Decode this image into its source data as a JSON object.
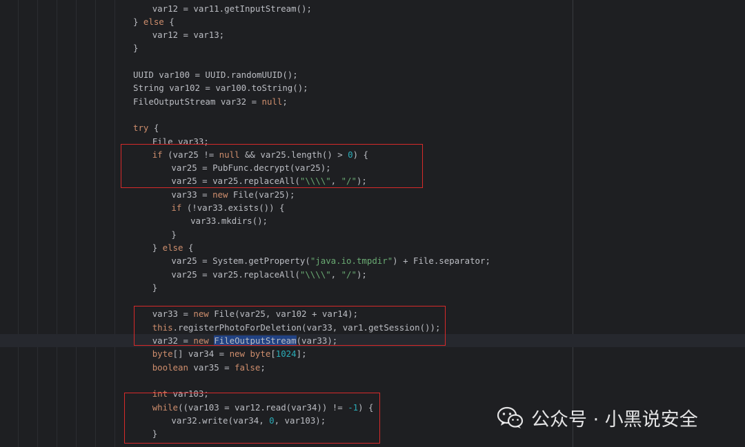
{
  "code_lines": [
    [
      {
        "t": "var12 = var11.getInputStream();",
        "c": ""
      }
    ],
    [
      {
        "t": "} ",
        "c": ""
      },
      {
        "t": "else",
        "c": "kw"
      },
      {
        "t": " {",
        "c": ""
      }
    ],
    [
      {
        "t": "var12 = var13;",
        "c": ""
      }
    ],
    [
      {
        "t": "}",
        "c": ""
      }
    ],
    [],
    [
      {
        "t": "UUID var100 = UUID.randomUUID();",
        "c": ""
      }
    ],
    [
      {
        "t": "String var102 = var100.toString();",
        "c": ""
      }
    ],
    [
      {
        "t": "FileOutputStream var32 = ",
        "c": ""
      },
      {
        "t": "null",
        "c": "kw"
      },
      {
        "t": ";",
        "c": ""
      }
    ],
    [],
    [
      {
        "t": "try",
        "c": "kw"
      },
      {
        "t": " {",
        "c": ""
      }
    ],
    [
      {
        "t": "File var33;",
        "c": ""
      }
    ],
    [
      {
        "t": "if",
        "c": "kw"
      },
      {
        "t": " (var25 != ",
        "c": ""
      },
      {
        "t": "null",
        "c": "kw"
      },
      {
        "t": " && var25.length() > ",
        "c": ""
      },
      {
        "t": "0",
        "c": "num"
      },
      {
        "t": ") {",
        "c": ""
      }
    ],
    [
      {
        "t": "var25 = PubFunc.decrypt(var25);",
        "c": ""
      }
    ],
    [
      {
        "t": "var25 = var25.replaceAll(",
        "c": ""
      },
      {
        "t": "\"\\\\\\\\\"",
        "c": "str"
      },
      {
        "t": ", ",
        "c": ""
      },
      {
        "t": "\"/\"",
        "c": "str"
      },
      {
        "t": ");",
        "c": ""
      }
    ],
    [
      {
        "t": "var33 = ",
        "c": ""
      },
      {
        "t": "new",
        "c": "kw"
      },
      {
        "t": " File(var25);",
        "c": ""
      }
    ],
    [
      {
        "t": "if",
        "c": "kw"
      },
      {
        "t": " (!var33.exists()) {",
        "c": ""
      }
    ],
    [
      {
        "t": "var33.mkdirs();",
        "c": ""
      }
    ],
    [
      {
        "t": "}",
        "c": ""
      }
    ],
    [
      {
        "t": "} ",
        "c": ""
      },
      {
        "t": "else",
        "c": "kw"
      },
      {
        "t": " {",
        "c": ""
      }
    ],
    [
      {
        "t": "var25 = System.getProperty(",
        "c": ""
      },
      {
        "t": "\"java.io.tmpdir\"",
        "c": "str"
      },
      {
        "t": ") + File.separator;",
        "c": ""
      }
    ],
    [
      {
        "t": "var25 = var25.replaceAll(",
        "c": ""
      },
      {
        "t": "\"\\\\\\\\\"",
        "c": "str"
      },
      {
        "t": ", ",
        "c": ""
      },
      {
        "t": "\"/\"",
        "c": "str"
      },
      {
        "t": ");",
        "c": ""
      }
    ],
    [
      {
        "t": "}",
        "c": ""
      }
    ],
    [],
    [
      {
        "t": "var33 = ",
        "c": ""
      },
      {
        "t": "new",
        "c": "kw"
      },
      {
        "t": " File(var25, var102 + var14);",
        "c": ""
      }
    ],
    [
      {
        "t": "this",
        "c": "kw"
      },
      {
        "t": ".registerPhotoForDeletion(var33, var1.getSession());",
        "c": ""
      }
    ],
    [
      {
        "t": "var32 = ",
        "c": ""
      },
      {
        "t": "new",
        "c": "kw"
      },
      {
        "t": " ",
        "c": ""
      },
      {
        "t": "FileOutputStream",
        "c": "hl"
      },
      {
        "t": "(var33);",
        "c": ""
      }
    ],
    [
      {
        "t": "byte",
        "c": "kw"
      },
      {
        "t": "[] var34 = ",
        "c": ""
      },
      {
        "t": "new",
        "c": "kw"
      },
      {
        "t": " ",
        "c": ""
      },
      {
        "t": "byte",
        "c": "kw"
      },
      {
        "t": "[",
        "c": ""
      },
      {
        "t": "1024",
        "c": "num"
      },
      {
        "t": "];",
        "c": ""
      }
    ],
    [
      {
        "t": "boolean",
        "c": "kw"
      },
      {
        "t": " var35 = ",
        "c": ""
      },
      {
        "t": "false",
        "c": "kw"
      },
      {
        "t": ";",
        "c": ""
      }
    ],
    [],
    [
      {
        "t": "int",
        "c": "kw"
      },
      {
        "t": " var103;",
        "c": ""
      }
    ],
    [
      {
        "t": "while",
        "c": "kw"
      },
      {
        "t": "((var103 = var12.read(var34)) != ",
        "c": ""
      },
      {
        "t": "-1",
        "c": "num"
      },
      {
        "t": ") {",
        "c": ""
      }
    ],
    [
      {
        "t": "var32.write(var34, ",
        "c": ""
      },
      {
        "t": "0",
        "c": "num"
      },
      {
        "t": ", var103);",
        "c": ""
      }
    ],
    [
      {
        "t": "}",
        "c": ""
      }
    ]
  ],
  "watermark": {
    "text": "公众号 · 小黑说安全",
    "icon": "wechat-icon"
  },
  "colors": {
    "background": "#1e1f22",
    "text": "#bcbec4",
    "keyword": "#cf8e6d",
    "string": "#6aab73",
    "number": "#2aacb8",
    "search_highlight": "#214283",
    "annotation_box": "#d92a2a"
  }
}
